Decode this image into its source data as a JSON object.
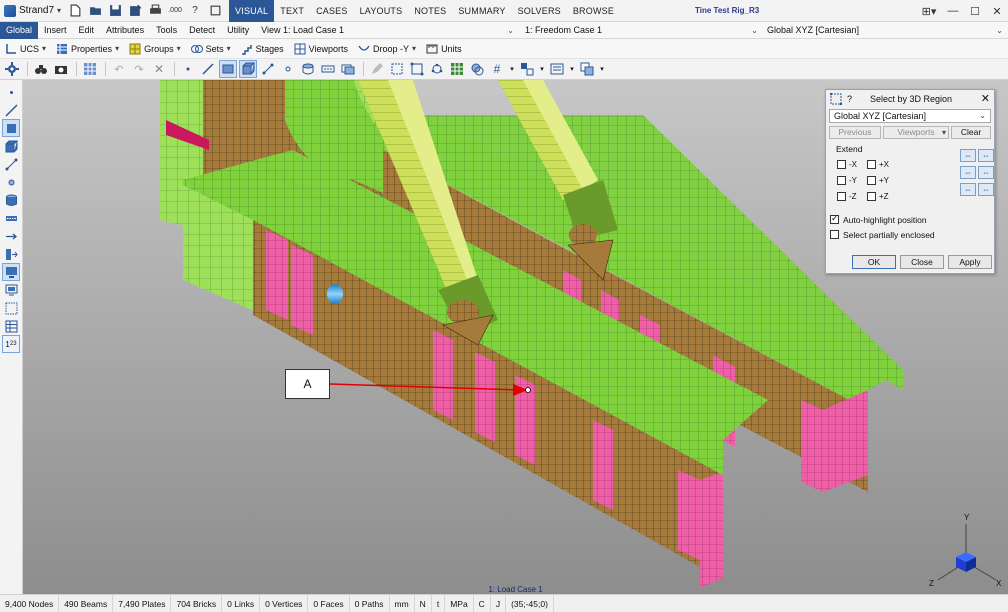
{
  "app": {
    "name": "Strand7",
    "document_title": "Tine Test Rig_R3"
  },
  "menu": {
    "tabs": [
      "VISUAL",
      "TEXT",
      "CASES",
      "LAYOUTS",
      "NOTES",
      "SUMMARY",
      "SOLVERS",
      "BROWSE"
    ],
    "active": "VISUAL"
  },
  "subtabs": {
    "items": [
      "Global",
      "Insert",
      "Edit",
      "Attributes",
      "Tools",
      "Detect",
      "Utility",
      "View"
    ],
    "active": "Global"
  },
  "selectors": {
    "load_case": "1: Load Case 1",
    "freedom_case": "1: Freedom Case 1",
    "ucs": "Global XYZ [Cartesian]"
  },
  "toolbar1": {
    "ucs": "UCS",
    "properties": "Properties",
    "groups": "Groups",
    "sets": "Sets",
    "stages": "Stages",
    "viewports": "Viewports",
    "droop": "Droop -Y",
    "units": "Units"
  },
  "viewport": {
    "caption": "1: Load Case 1",
    "callout_label": "A"
  },
  "dialog": {
    "title": "Select by 3D Region",
    "help": "?",
    "coord_system": "Global XYZ [Cartesian]",
    "buttons": {
      "previous": "Previous",
      "viewports": "Viewports",
      "clear": "Clear"
    },
    "extend_label": "Extend",
    "extend": {
      "minus_x": "-X",
      "plus_x": "+X",
      "minus_y": "-Y",
      "plus_y": "+Y",
      "minus_z": "-Z",
      "plus_z": "+Z"
    },
    "options": {
      "auto_highlight": "Auto-highlight position",
      "auto_highlight_checked": true,
      "select_partial": "Select partially enclosed",
      "select_partial_checked": false
    },
    "footer": {
      "ok": "OK",
      "close": "Close",
      "apply": "Apply"
    }
  },
  "triad": {
    "x": "X",
    "y": "Y",
    "z": "Z"
  },
  "status": {
    "nodes": "9,400 Nodes",
    "beams": "490 Beams",
    "plates": "7,490 Plates",
    "bricks": "704 Bricks",
    "links": "0 Links",
    "vertices": "0 Vertices",
    "faces": "0 Faces",
    "paths": "0 Paths",
    "unit_length": "mm",
    "unit_force": "N",
    "unit_mass": "t",
    "unit_stress": "MPa",
    "unit_temp": "C",
    "unit_energy": "J",
    "coords": "(35;-45;0)"
  },
  "colors": {
    "accent": "#2b5797",
    "plate_green": "#7fd23c",
    "plate_brown": "#a57a3a",
    "plate_pink": "#ef5fa7",
    "beam_blue": "#3aa6e0",
    "tine_yellow": "#cde05a"
  }
}
